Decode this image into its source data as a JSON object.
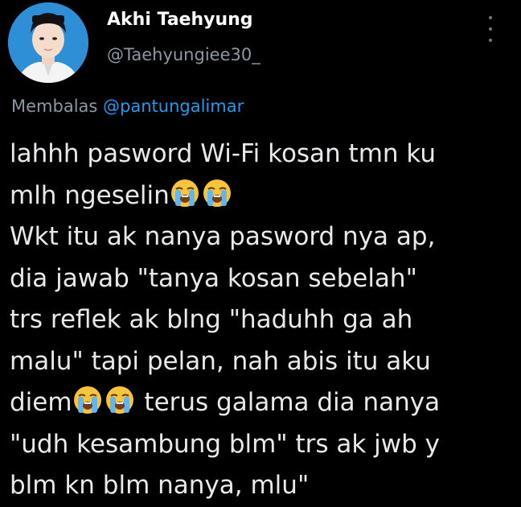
{
  "author": {
    "display_name": "Akhi Taehyung",
    "handle": "@Taehyungiee30_",
    "avatar_icon": "profile-photo",
    "avatar_bg": "#2f8fd6"
  },
  "reply_context": {
    "prefix": "Membalas",
    "mention": "@pantungalimar"
  },
  "tweet": {
    "lines": [
      {
        "text": "lahhh pasword Wi-Fi kosan tmn ku",
        "emoji_after": 0
      },
      {
        "text": "mlh ngeselin",
        "emoji_after": 2
      },
      {
        "text": "Wkt itu ak nanya pasword nya ap,",
        "emoji_after": 0
      },
      {
        "text": "dia jawab \"tanya kosan sebelah\"",
        "emoji_after": 0
      },
      {
        "text": "trs reflek ak blng \"haduhh ga ah",
        "emoji_after": 0
      },
      {
        "text": "malu\" tapi pelan, nah abis itu aku",
        "emoji_after": 0
      },
      {
        "text": "diem",
        "emoji_after": 2,
        "text_after_emoji": " terus galama dia nanya"
      },
      {
        "text": "\"udh kesambung blm\" trs ak jwb y",
        "emoji_after": 0
      },
      {
        "text": "blm kn blm nanya, mlu\"",
        "emoji_after": 0
      }
    ],
    "emoji_name": "loudly-crying-face"
  },
  "colors": {
    "background": "#000000",
    "text": "#e7e9ea",
    "muted": "#8b98a5",
    "link": "#1d9bf0"
  }
}
